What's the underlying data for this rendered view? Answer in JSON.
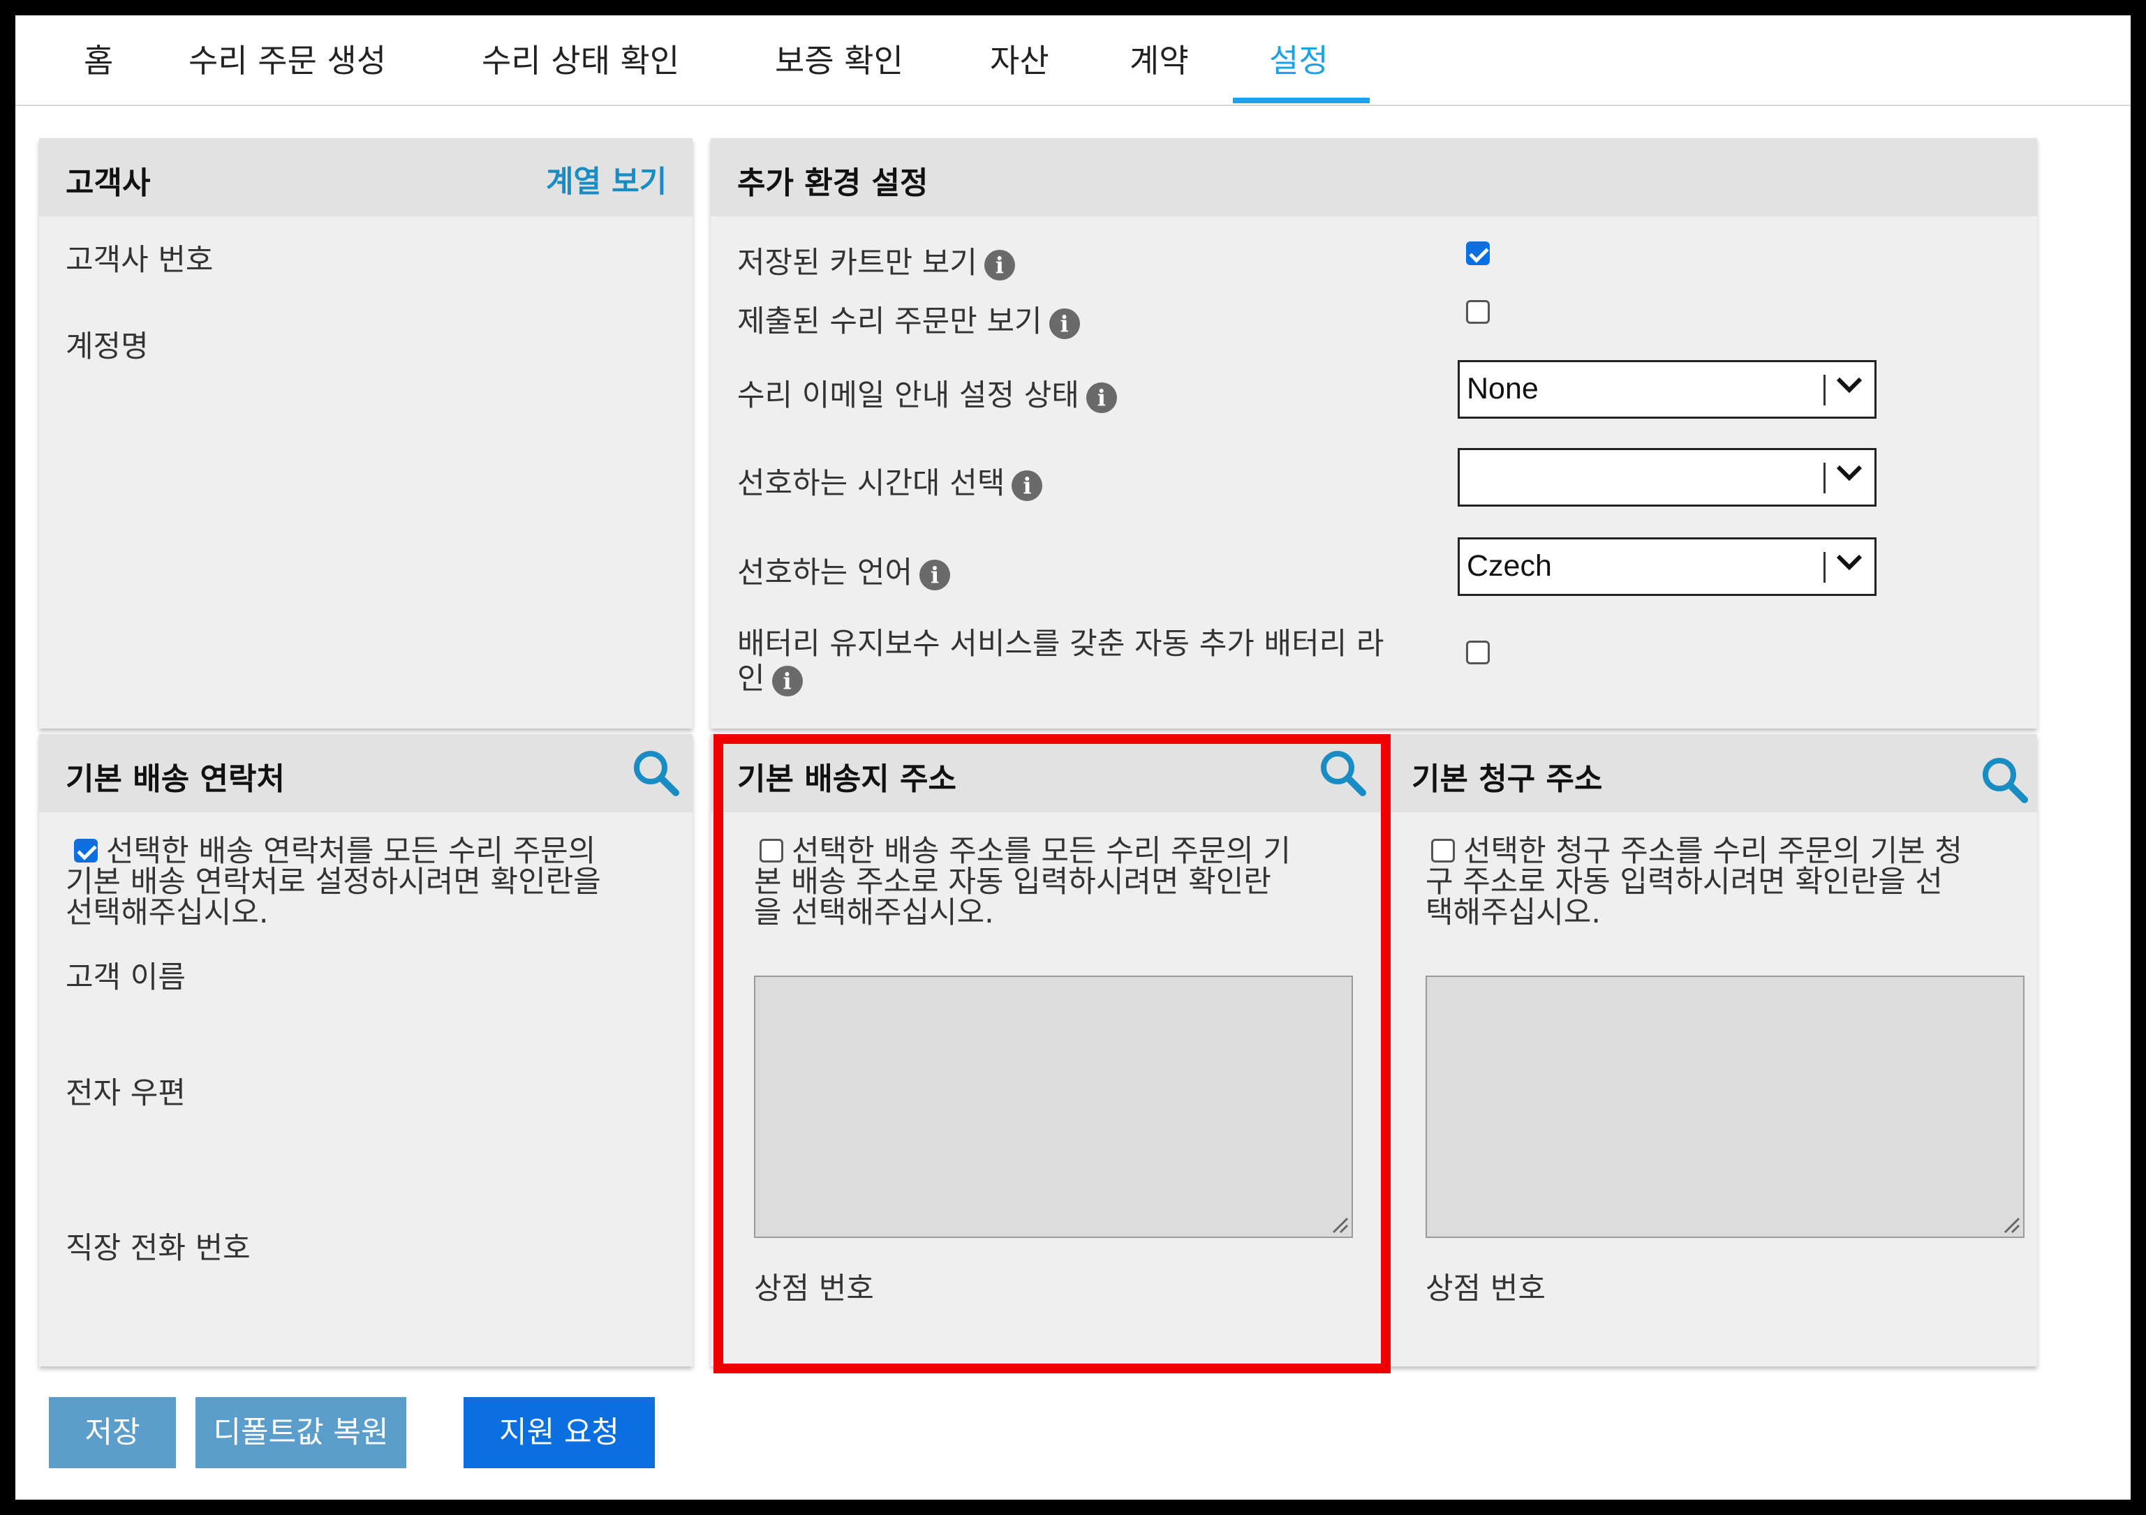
{
  "nav": {
    "tabs": [
      {
        "label": "홈"
      },
      {
        "label": "수리 주문 생성"
      },
      {
        "label": "수리 상태 확인"
      },
      {
        "label": "보증 확인"
      },
      {
        "label": "자산"
      },
      {
        "label": "계약"
      },
      {
        "label": "설정"
      }
    ],
    "active_tab": "설정"
  },
  "customer_panel": {
    "title": "고객사",
    "hierarchy_link": "계열 보기",
    "number_label": "고객사 번호",
    "account_label": "계정명"
  },
  "env_panel": {
    "title": "추가 환경 설정",
    "rows": {
      "saved_carts": {
        "label": "저장된 카트만 보기",
        "checked": true
      },
      "submitted_orders": {
        "label": "제출된 수리 주문만 보기",
        "checked": false
      },
      "email_status": {
        "label": "수리 이메일 안내 설정 상태",
        "value": "None"
      },
      "timezone": {
        "label": "선호하는 시간대 선택",
        "value": ""
      },
      "language": {
        "label": "선호하는 언어",
        "value": "Czech"
      },
      "battery": {
        "label_line1": "배터리 유지보수 서비스를 갖춘 자동 추가 배터리 라",
        "label_line2": "인",
        "checked": false
      }
    }
  },
  "ship_contact_panel": {
    "title": "기본 배송 연락처",
    "checked": true,
    "instruction_line1": "선택한 배송 연락처를 모든 수리 주문의",
    "instruction_line2": "기본 배송 연락처로 설정하시려면 확인란을",
    "instruction_line3": "선택해주십시오.",
    "name_label": "고객 이름",
    "email_label": "전자 우편",
    "phone_label": "직장 전화 번호"
  },
  "ship_address_panel": {
    "title": "기본 배송지 주소",
    "checked": false,
    "instruction_line1": "선택한 배송 주소를 모든 수리 주문의 기",
    "instruction_line2": "본 배송 주소로 자동 입력하시려면 확인란",
    "instruction_line3": "을 선택해주십시오.",
    "store_label": "상점 번호"
  },
  "billing_panel": {
    "title": "기본 청구 주소",
    "checked": false,
    "instruction_line1": "선택한 청구 주소를 수리 주문의 기본 청",
    "instruction_line2": "구 주소로 자동 입력하시려면 확인란을 선",
    "instruction_line3": "택해주십시오.",
    "store_label": "상점 번호"
  },
  "buttons": {
    "save": "저장",
    "restore_defaults": "디폴트값 복원",
    "support": "지원 요청"
  },
  "colors": {
    "accent": "#1da1e8",
    "link": "#1a8cc4",
    "primary_button": "#0b6fe0",
    "secondary_button": "#5b9dcb",
    "highlight": "#ee0000",
    "panel_bg": "#efefef",
    "panel_header": "#e2e2e2"
  }
}
